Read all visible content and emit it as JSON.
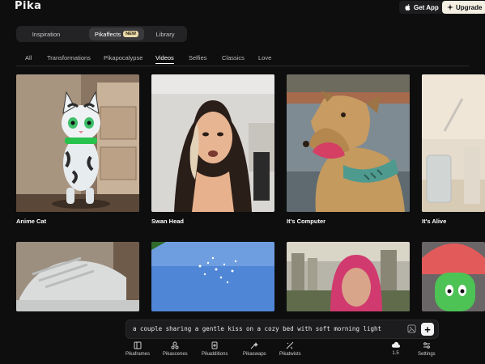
{
  "header": {
    "logo": "Pika",
    "get_app": "Get App",
    "upgrade": "Upgrade"
  },
  "modes": [
    {
      "label": "Inspiration",
      "active": false
    },
    {
      "label": "Pikaffects",
      "badge": "NEW",
      "active": true
    },
    {
      "label": "Library",
      "active": false
    }
  ],
  "categories": [
    "All",
    "Transformations",
    "Pikapocalypse",
    "Videos",
    "Selfies",
    "Classics",
    "Love"
  ],
  "active_category": "Videos",
  "cards": [
    {
      "title": "Anime Cat"
    },
    {
      "title": "Swan Head"
    },
    {
      "title": "It's Computer"
    },
    {
      "title": "It's Alive"
    }
  ],
  "prompt": {
    "value": "a couple sharing a gentle kiss on a cozy bed with soft morning light"
  },
  "toolbar": {
    "pikaframes": "Pikaframes",
    "pikascenes": "Pikascenes",
    "pikadditions": "Pikadditions",
    "pikaswaps": "Pikaswaps",
    "pikatwists": "Pikatwists",
    "model": "1.5",
    "settings": "Settings"
  }
}
